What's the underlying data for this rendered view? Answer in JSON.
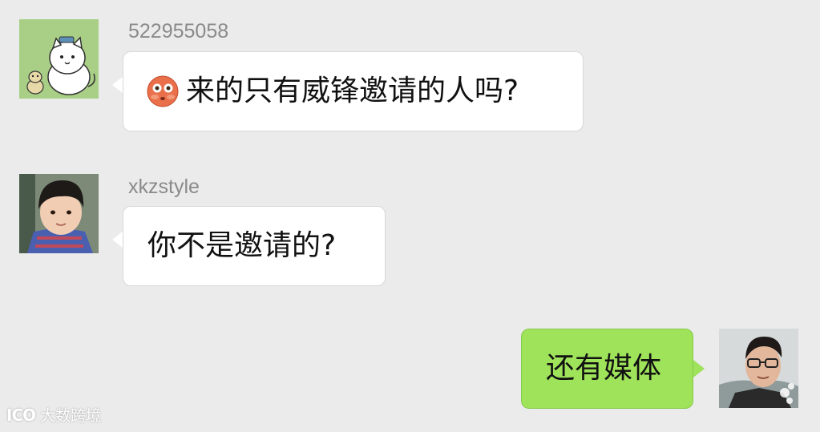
{
  "colors": {
    "background": "#ebebeb",
    "incoming_bubble": "#ffffff",
    "outgoing_bubble": "#9ee35a",
    "username_text": "#8a8a8a",
    "message_text": "#111111"
  },
  "messages": [
    {
      "direction": "incoming",
      "sender": "522955058",
      "avatar_icon": "cartoon-cat-avatar",
      "emoji_icon": "flushed-face-emoji",
      "text": "来的只有威锋邀请的人吗?"
    },
    {
      "direction": "incoming",
      "sender": "xkzstyle",
      "avatar_icon": "child-photo-avatar",
      "text": "你不是邀请的?"
    },
    {
      "direction": "outgoing",
      "avatar_icon": "man-with-glasses-avatar",
      "text": "还有媒体"
    }
  ],
  "watermark": {
    "logo": "ICO",
    "text": "大数跨境"
  }
}
